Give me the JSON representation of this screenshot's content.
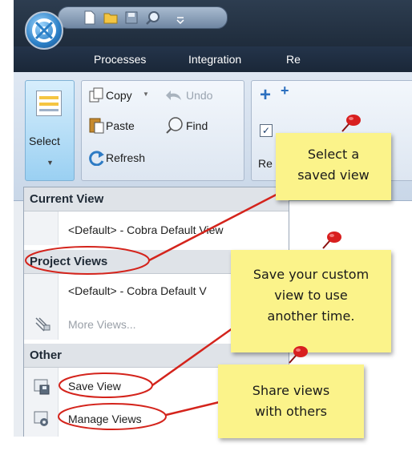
{
  "quick_access": {
    "icons": [
      "app-logo-icon",
      "new-document-icon",
      "open-folder-icon",
      "save-icon",
      "search-icon",
      "customize-dropdown-icon"
    ]
  },
  "menu": {
    "items": [
      "Processes",
      "Integration",
      "Re"
    ]
  },
  "ribbon": {
    "select_label": "Select",
    "copy_label": "Copy",
    "undo_label": "Undo",
    "paste_label": "Paste",
    "find_label": "Find",
    "refresh_label": "Refresh",
    "partial_label": "Re"
  },
  "dropdown": {
    "current_view_header": "Current View",
    "current_view_item": "<Default> - Cobra Default View",
    "project_views_header": "Project Views",
    "project_views_item": "<Default> - Cobra Default V",
    "more_views": "More Views...",
    "other_header": "Other",
    "save_view": "Save View",
    "manage_views": "Manage Views"
  },
  "notes": {
    "select_view_line1": "Select a",
    "select_view_line2": "saved view",
    "save_custom_line1": "Save your custom",
    "save_custom_line2": "view to use",
    "save_custom_line3": "another time.",
    "share_line1": "Share views",
    "share_line2": "with others"
  },
  "colors": {
    "annotation_red": "#d4241c",
    "note_yellow": "#fbf38a",
    "title_bar": "#2d3d50"
  }
}
